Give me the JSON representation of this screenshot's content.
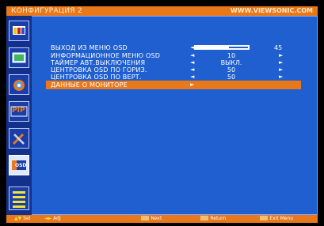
{
  "header": {
    "title": "КОНФИГУРАЦИЯ 2",
    "url": "WWW.VIEWSONIC.COM"
  },
  "sidebar": {
    "icons": [
      {
        "name": "picture-adjust-icon"
      },
      {
        "name": "color-adjust-icon"
      },
      {
        "name": "image-setup-icon"
      },
      {
        "name": "pip-icon",
        "label": "PIP"
      },
      {
        "name": "setup-tools-icon"
      },
      {
        "name": "osd-icon",
        "label": "OSD",
        "selected": true
      },
      {
        "name": "menu-list-icon"
      }
    ]
  },
  "menu": {
    "items": [
      {
        "label": "ВЫХОД ИЗ МЕНЮ OSD",
        "type": "bar",
        "value": "45",
        "level": 0.62
      },
      {
        "label": "ИНФОРМАЦИОННОЕ МЕНЮ OSD",
        "type": "value",
        "value": "10"
      },
      {
        "label": "ТАЙМЕР АВТ.ВЫКЛЮЧЕНИЯ",
        "type": "value",
        "value": "ВЫКЛ."
      },
      {
        "label": "ЦЕНТРОВКА OSD ПО ГОРИЗ.",
        "type": "value",
        "value": "50"
      },
      {
        "label": "ЦЕНТРОВКА OSD ПО ВЕРТ.",
        "type": "value",
        "value": "50"
      },
      {
        "label": "ДАННЫЕ О МОНИТОРЕ",
        "type": "submenu",
        "highlighted": true
      }
    ],
    "arrow_left": "◄",
    "arrow_right": "►"
  },
  "footer": {
    "sel": "Sel",
    "adj": "Adj",
    "next": "Next",
    "return": "Return",
    "exit": "Exit Menu"
  },
  "colors": {
    "accent": "#e8781a",
    "panel": "#1f5fcf",
    "sidebar": "#13308a"
  }
}
